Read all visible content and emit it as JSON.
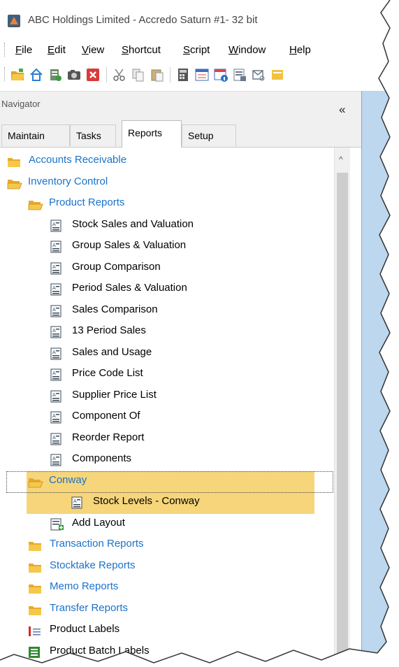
{
  "window": {
    "title": "ABC Holdings Limited - Accredo Saturn #1- 32 bit"
  },
  "menu": [
    {
      "label": "File",
      "key": "F",
      "rest": "ile"
    },
    {
      "label": "Edit",
      "key": "E",
      "rest": "dit"
    },
    {
      "label": "View",
      "key": "V",
      "rest": "iew"
    },
    {
      "label": "Shortcut",
      "key": "S",
      "rest": "hortcut"
    },
    {
      "label": "Script",
      "key": "S",
      "rest": "cript"
    },
    {
      "label": "Window",
      "key": "W",
      "rest": "indow"
    },
    {
      "label": "Help",
      "key": "H",
      "rest": "elp"
    }
  ],
  "toolbar": {
    "icons": [
      "open-folder-icon",
      "home-icon",
      "database-icon",
      "camera-icon",
      "close-red-icon",
      "cut-icon",
      "copy-icon",
      "paste-icon",
      "calculator-icon",
      "calendar-icon",
      "calendar-info-icon",
      "report-icon",
      "inbox-icon",
      "notes-icon"
    ]
  },
  "navigator": {
    "title": "Navigator",
    "collapse": "«",
    "tabs": [
      "Maintain",
      "Tasks",
      "Reports",
      "Setup"
    ],
    "active_tab": "Reports"
  },
  "tree": {
    "items": [
      {
        "label": "Accounts Receivable",
        "type": "folder"
      },
      {
        "label": "Inventory Control",
        "type": "folder-open"
      },
      {
        "label": "Product Reports",
        "type": "folder-open"
      },
      {
        "label": "Stock Sales and Valuation",
        "type": "report"
      },
      {
        "label": "Group Sales & Valuation",
        "type": "report"
      },
      {
        "label": "Group Comparison",
        "type": "report"
      },
      {
        "label": "Period Sales & Valuation",
        "type": "report"
      },
      {
        "label": "Sales Comparison",
        "type": "report"
      },
      {
        "label": "13 Period Sales",
        "type": "report"
      },
      {
        "label": "Sales and Usage",
        "type": "report"
      },
      {
        "label": "Price Code List",
        "type": "report"
      },
      {
        "label": "Supplier Price List",
        "type": "report"
      },
      {
        "label": "Component Of",
        "type": "report"
      },
      {
        "label": "Reorder Report",
        "type": "report"
      },
      {
        "label": "Components",
        "type": "report"
      },
      {
        "label": "Conway",
        "type": "folder-open"
      },
      {
        "label": "Stock Levels - Conway",
        "type": "report"
      },
      {
        "label": "Add Layout",
        "type": "add-layout"
      },
      {
        "label": "Transaction Reports",
        "type": "folder"
      },
      {
        "label": "Stocktake Reports",
        "type": "folder"
      },
      {
        "label": "Memo Reports",
        "type": "folder"
      },
      {
        "label": "Transfer Reports",
        "type": "folder"
      },
      {
        "label": "Product Labels",
        "type": "label"
      },
      {
        "label": "Product Batch Labels",
        "type": "label-batch"
      }
    ]
  },
  "colors": {
    "folder_text": "#1a73c9",
    "highlight": "#f6d57b",
    "folder_fill": "#f2c23e",
    "workspace": "#bcd7ee"
  }
}
